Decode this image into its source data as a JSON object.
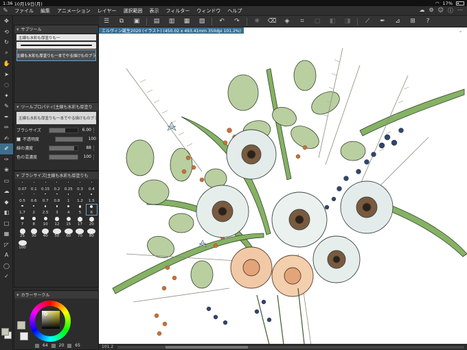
{
  "status": {
    "time": "1:36",
    "date": "10月19日(月)",
    "battery": "17%"
  },
  "menubar": {
    "items": [
      "ファイル",
      "編集",
      "アニメーション",
      "レイヤー",
      "選択範囲",
      "表示",
      "フィルター",
      "ウィンドウ",
      "ヘルプ"
    ]
  },
  "document": {
    "tab_title": "エルヴィン誕生2020 (イラスト) (450.02 x 493.41mm 350dpi 101.2%)",
    "zoom": "101.2"
  },
  "subtool": {
    "header": "サブツール",
    "tab_label": "主線も水彩も厚塗りも一",
    "selected_label": "主線も水彩も厚塗りも一本でやる描けものブラ"
  },
  "tool_property": {
    "header": "ツールプロパティ[主線も水彩も厚塗り",
    "preview_label": "主線も水彩も厚塗りも一本でやる描けものブラシ",
    "rows": [
      {
        "label": "ブラシサイズ",
        "value": "6.00",
        "level": 0.55
      },
      {
        "label": "不透明度",
        "value": "100",
        "level": 1.0
      },
      {
        "label": "線の濃度",
        "value": "88",
        "level": 0.88
      },
      {
        "label": "色の混濃度",
        "value": "100",
        "level": 1.0
      }
    ]
  },
  "brush_size": {
    "header": "ブラシサイズ[主線も水彩も厚塗りも",
    "sizes": [
      "0.07",
      "0.1",
      "0.15",
      "0.2",
      "0.25",
      "0.3",
      "0.4",
      "0.5",
      "0.6",
      "0.7",
      "0.8",
      "1",
      "1.2",
      "1.5",
      "1.7",
      "2",
      "2.5",
      "3",
      "4",
      "5",
      "6",
      "7",
      "8",
      "10",
      "12",
      "15",
      "17",
      "20",
      "25",
      "30",
      "40",
      "50",
      "60",
      "70",
      "80",
      "100"
    ]
  },
  "color_circle": {
    "header": "カラーサークル",
    "h": "64",
    "s": "20",
    "v": "65"
  },
  "colors": {
    "main": "#c8c8b4",
    "sub": "#ececec",
    "accent": "#3b6d8f"
  }
}
